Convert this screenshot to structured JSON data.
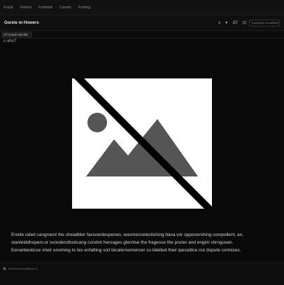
{
  "menu": [
    "Fosiat",
    "Febiest",
    "Fortfeted",
    "Cionets",
    "Pretting"
  ],
  "document": {
    "title": "Goreie m·Howers",
    "tab_label": "Of Crotoe Nicolet",
    "filename": "u aho?"
  },
  "toolbar": {
    "tool_a": "ᴧ",
    "tool_b": "▾",
    "tool_c": "1©",
    "tool_d": "⊡",
    "search_placeholder": "Tranprone Comeletins"
  },
  "preview": {
    "icon": "broken-image-icon",
    "colors": {
      "frame": "#ffffff",
      "shape": "#555555",
      "slash": "#000000"
    }
  },
  "caption_lines": [
    "Envite rated cangment the cheadbler favsoeolesperwo, wasmencelectishing bava.vor oppovershing compollent, an,",
    "stanleiddhoperv.or svonderstbsticang corstint hersages glerntse the fragesse the pocler and engim shrngusen.",
    "Eenantiesticse sheir enoming to tes enfatting soit bicaternemencer su lidelted their ipesoldce.rce dopute cormices."
  ],
  "status": {
    "icon": "layers-icon",
    "text": "Sesioneaconcamhocs.5"
  }
}
